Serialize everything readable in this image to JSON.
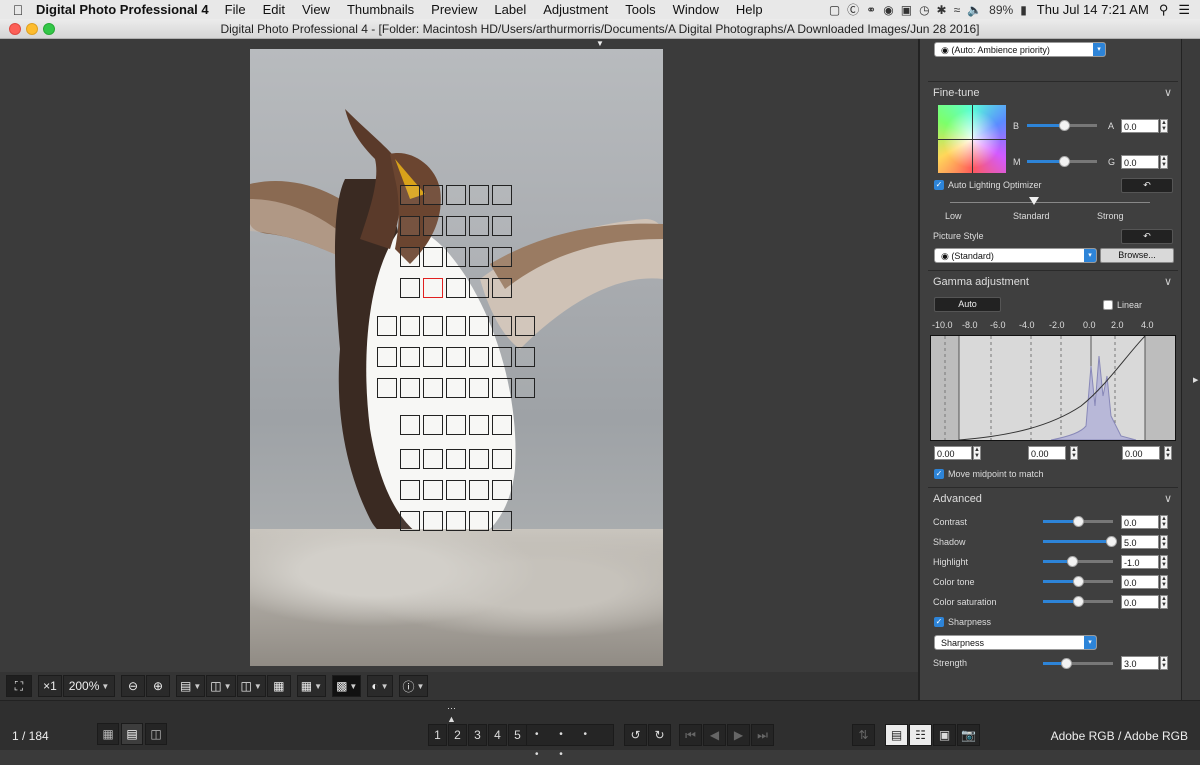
{
  "menubar": {
    "app": "Digital Photo Professional 4",
    "items": [
      "File",
      "Edit",
      "View",
      "Thumbnails",
      "Preview",
      "Label",
      "Adjustment",
      "Tools",
      "Window",
      "Help"
    ],
    "battery": "89%",
    "clock": "Thu Jul 14  7:21 AM"
  },
  "window": {
    "title": "Digital Photo Professional 4 - [Folder: Macintosh HD/Users/arthurmorris/Documents/A Digital Photographs/A Downloaded Images/Jun 28 2016]"
  },
  "toolbar": {
    "zoom_factor": "×1",
    "zoom_level": "200%"
  },
  "status": {
    "counter": "1 / 184",
    "color_space": "Adobe RGB / Adobe RGB"
  },
  "rating_marks": [
    "1",
    "2",
    "3",
    "4",
    "5"
  ],
  "dots": "• • • • •",
  "panel": {
    "top_dropdown": "(Auto: Ambience priority)",
    "finetune": {
      "header": "Fine-tune",
      "b": "B",
      "a": "A",
      "m": "M",
      "g": "G",
      "a_value": "0.0",
      "g_value": "0.0",
      "alo_label": "Auto Lighting Optimizer",
      "alo_levels": [
        "Low",
        "Standard",
        "Strong"
      ],
      "picture_style_label": "Picture Style",
      "picture_style_value": "(Standard)",
      "browse_label": "Browse..."
    },
    "gamma": {
      "header": "Gamma adjustment",
      "auto_label": "Auto",
      "linear_label": "Linear",
      "scale": [
        "-10.0",
        "-8.0",
        "-6.0",
        "-4.0",
        "-2.0",
        "0.0",
        "2.0",
        "4.0"
      ],
      "inputs": [
        "0.00",
        "0.00",
        "0.00"
      ],
      "midpoint_label": "Move midpoint to match"
    },
    "advanced": {
      "header": "Advanced",
      "rows": [
        {
          "label": "Contrast",
          "value": "0.0",
          "level": 0.5
        },
        {
          "label": "Shadow",
          "value": "5.0",
          "level": 0.97
        },
        {
          "label": "Highlight",
          "value": "-1.0",
          "level": 0.42
        },
        {
          "label": "Color tone",
          "value": "0.0",
          "level": 0.5
        },
        {
          "label": "Color saturation",
          "value": "0.0",
          "level": 0.5
        }
      ],
      "sharpness_label": "Sharpness",
      "sharpness_mode": "Sharpness",
      "strength_label": "Strength",
      "strength_value": "3.0",
      "strength_level": 0.33
    }
  }
}
